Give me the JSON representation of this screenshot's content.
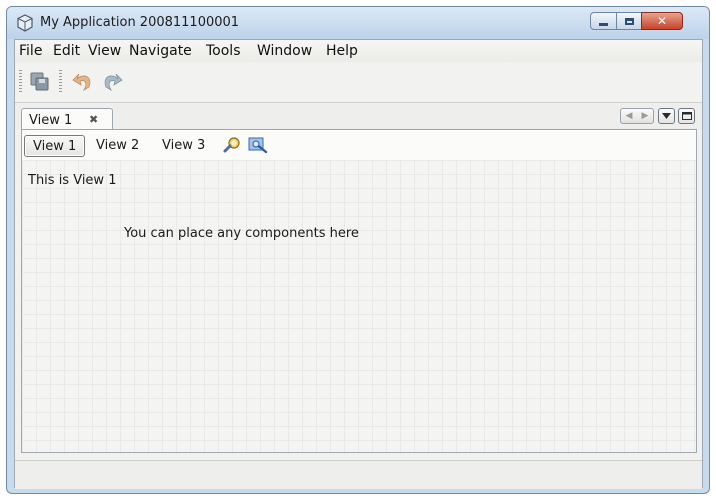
{
  "window": {
    "title": "My Application 200811100001",
    "buttons": [
      "minimize",
      "maximize",
      "close"
    ]
  },
  "menubar": {
    "items": [
      "File",
      "Edit",
      "View",
      "Navigate",
      "Tools",
      "Window",
      "Help"
    ]
  },
  "toolbar": {
    "buttons": [
      {
        "icon": "save-all-icon",
        "enabled": false
      },
      {
        "icon": "undo-icon",
        "enabled": false
      },
      {
        "icon": "redo-icon",
        "enabled": false
      }
    ]
  },
  "document_tab": {
    "label": "View 1",
    "close_icon": "close-icon"
  },
  "panel_controls": [
    "scroll-left-icon",
    "scroll-right-icon",
    "dropdown-icon",
    "maximize-icon"
  ],
  "subtabs": [
    "View 1",
    "View 2",
    "View 3"
  ],
  "subtab_icons": [
    "search-icon",
    "zoom-area-icon"
  ],
  "content": {
    "title": "This is View 1",
    "hint": "You can place any components here"
  },
  "colors": {
    "window_frame": "#c7dbef",
    "close_button": "#c6442c"
  }
}
